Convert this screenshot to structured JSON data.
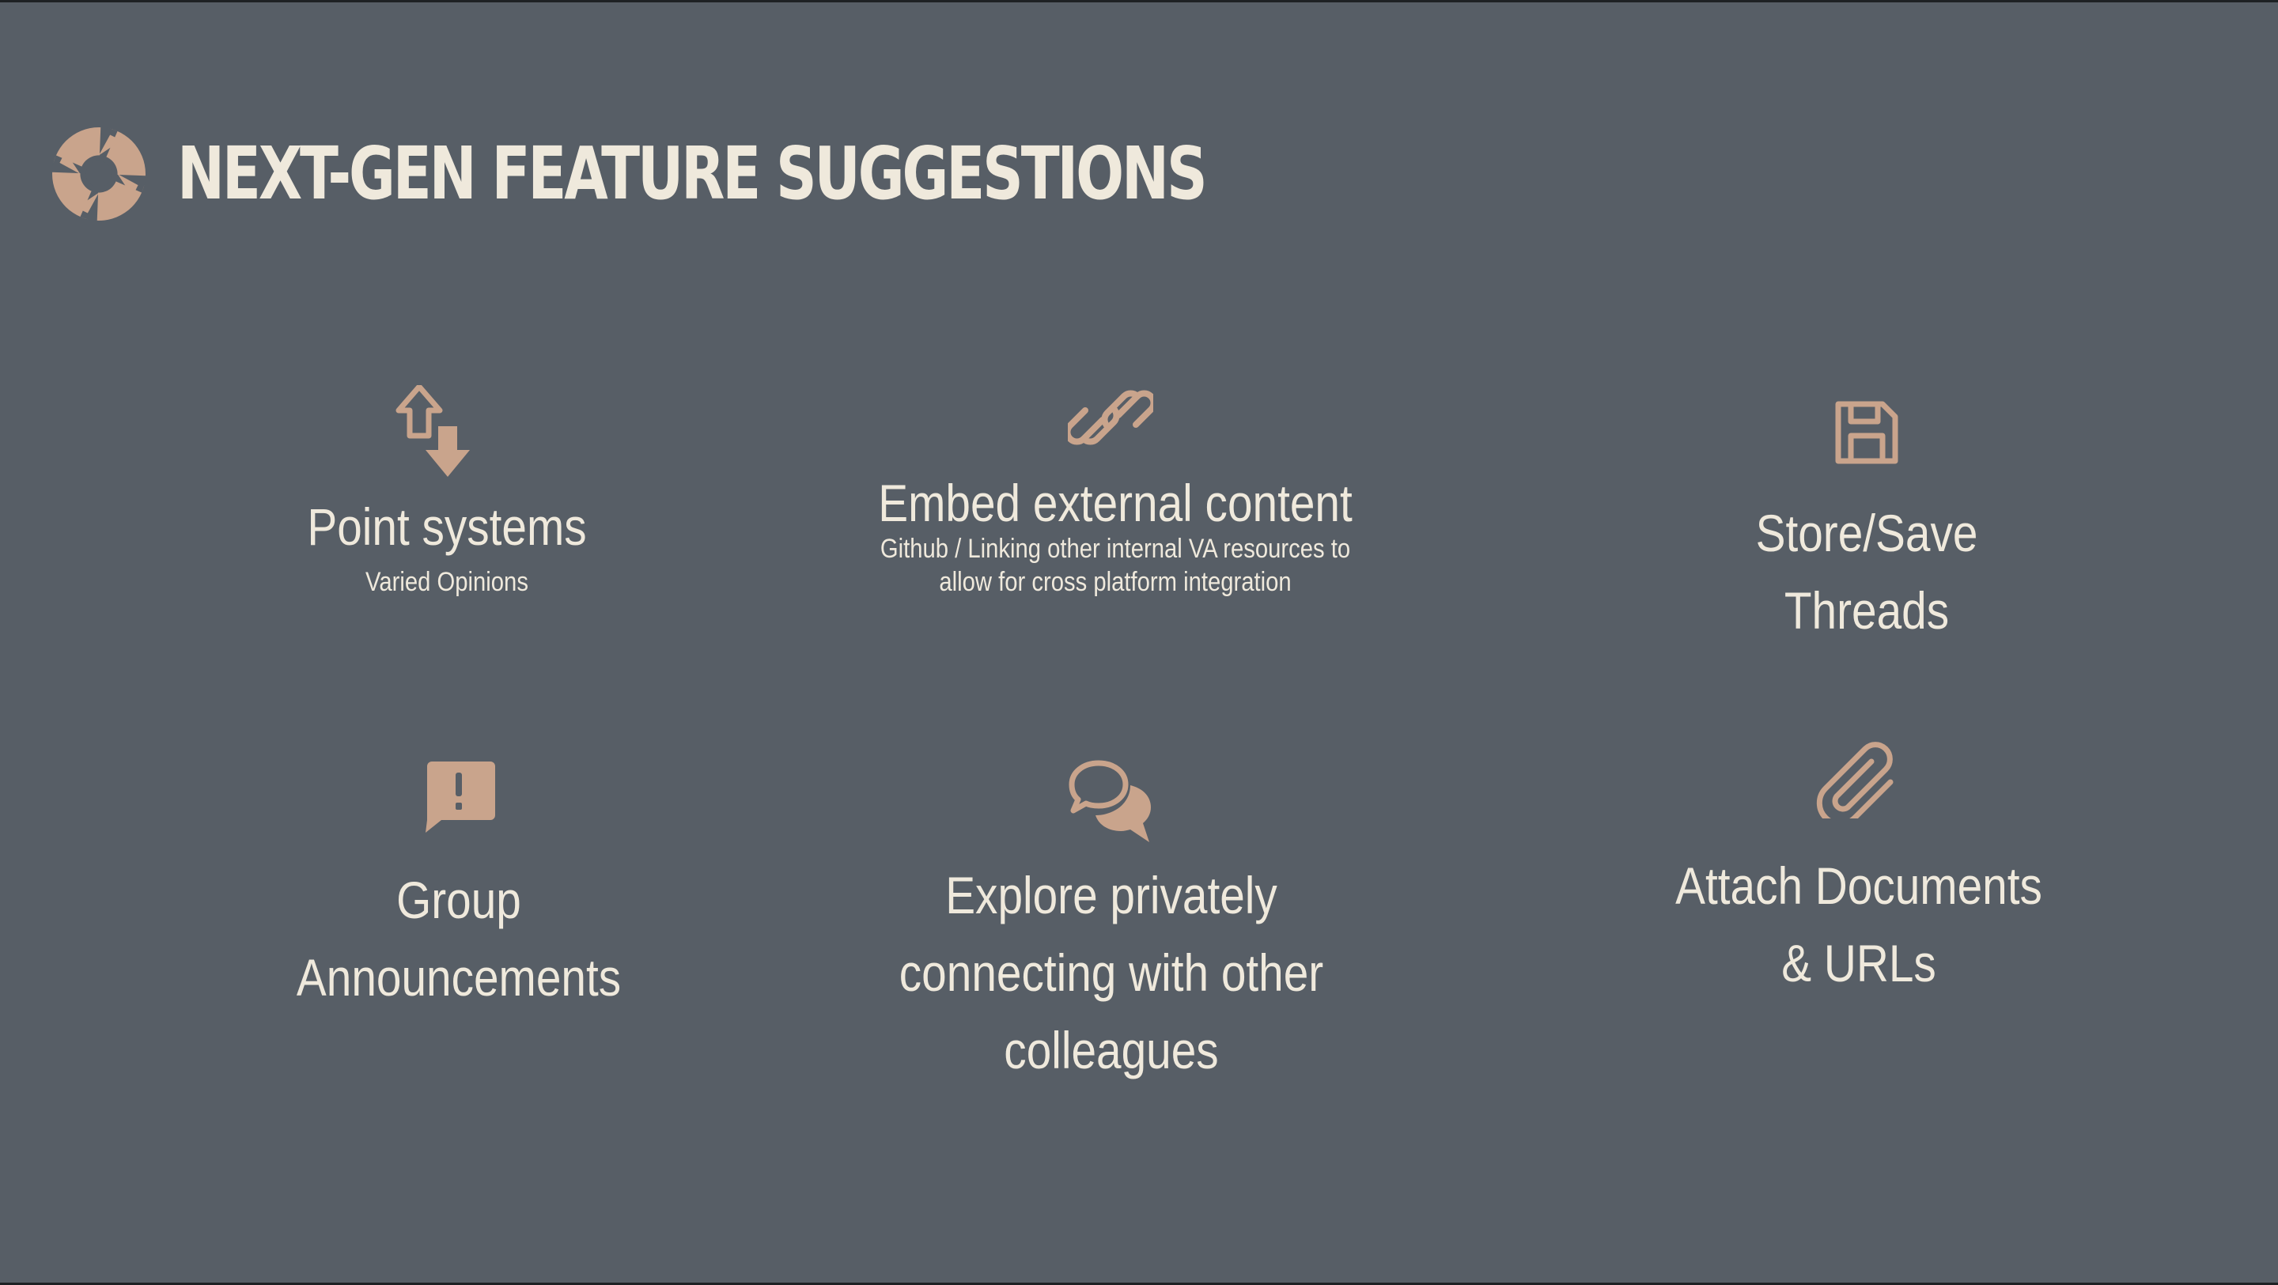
{
  "slide": {
    "title": "NEXT-GEN FEATURE SUGGESTIONS",
    "logo_icon": "aperture-icon",
    "accent_color": "#c9a48c",
    "text_color": "#efe9dc",
    "background_color": "#575e66"
  },
  "features": [
    {
      "icon": "arrows-up-down-icon",
      "label": "Point systems",
      "sub": "Varied Opinions"
    },
    {
      "icon": "link-icon",
      "label": "Embed external content",
      "sub": "Github / Linking other internal VA resources to\nallow for cross platform integration"
    },
    {
      "icon": "floppy-disk-icon",
      "label": "Store/Save\nThreads",
      "sub": ""
    },
    {
      "icon": "alert-message-icon",
      "label": "Group\nAnnouncements",
      "sub": ""
    },
    {
      "icon": "chat-bubbles-icon",
      "label": "Explore privately\nconnecting with other\ncolleagues",
      "sub": ""
    },
    {
      "icon": "paperclip-icon",
      "label": "Attach Documents\n& URLs",
      "sub": ""
    }
  ]
}
